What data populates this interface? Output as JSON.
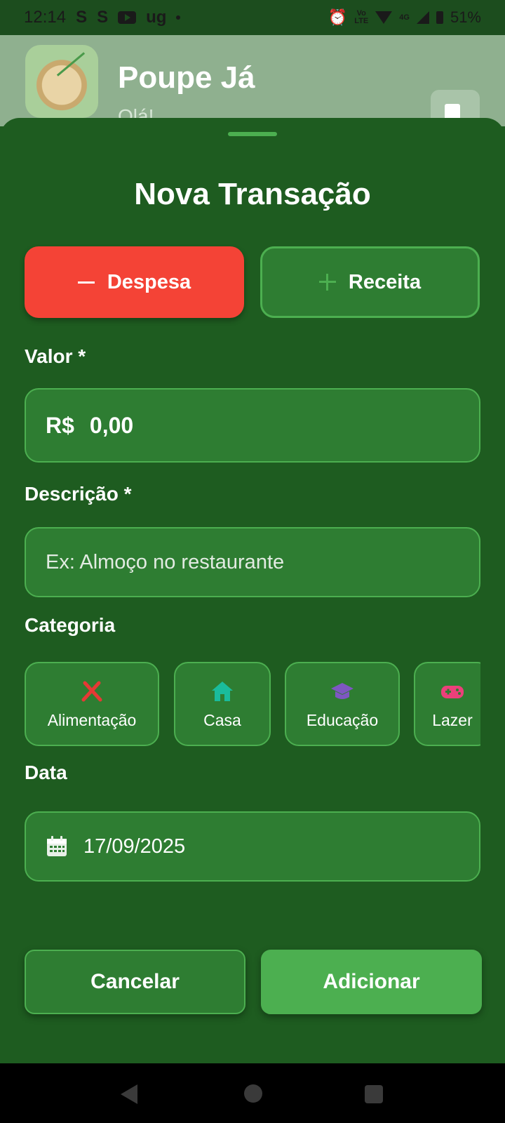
{
  "status_bar": {
    "time": "12:14",
    "notif_glyph_1": "S",
    "notif_glyph_2": "S",
    "notif_app": "ug",
    "volte": "Vo\nLTE",
    "network": "4G",
    "battery": "51%"
  },
  "app": {
    "title": "Poupe Já",
    "greeting": "Olá!"
  },
  "sheet": {
    "title": "Nova Transação",
    "types": [
      {
        "label": "Despesa",
        "icon": "minus-icon",
        "selected": true
      },
      {
        "label": "Receita",
        "icon": "plus-icon",
        "selected": false
      }
    ],
    "value": {
      "label": "Valor *",
      "currency": "R$",
      "amount": "0,00"
    },
    "description": {
      "label": "Descrição *",
      "placeholder": "Ex: Almoço no restaurante"
    },
    "category": {
      "label": "Categoria",
      "items": [
        {
          "label": "Alimentação",
          "icon": "utensils-icon",
          "color": "#e53935"
        },
        {
          "label": "Casa",
          "icon": "house-icon",
          "color": "#1abc9c"
        },
        {
          "label": "Educação",
          "icon": "graduation-cap-icon",
          "color": "#7e57c2"
        },
        {
          "label": "Lazer",
          "icon": "gamepad-icon",
          "color": "#ec407a"
        }
      ]
    },
    "date": {
      "label": "Data",
      "value": "17/09/2025"
    },
    "actions": {
      "cancel": "Cancelar",
      "add": "Adicionar"
    }
  },
  "colors": {
    "background": "#1e5c20",
    "card": "#2e7d32",
    "accent": "#4caf50",
    "expense": "#f44336"
  }
}
